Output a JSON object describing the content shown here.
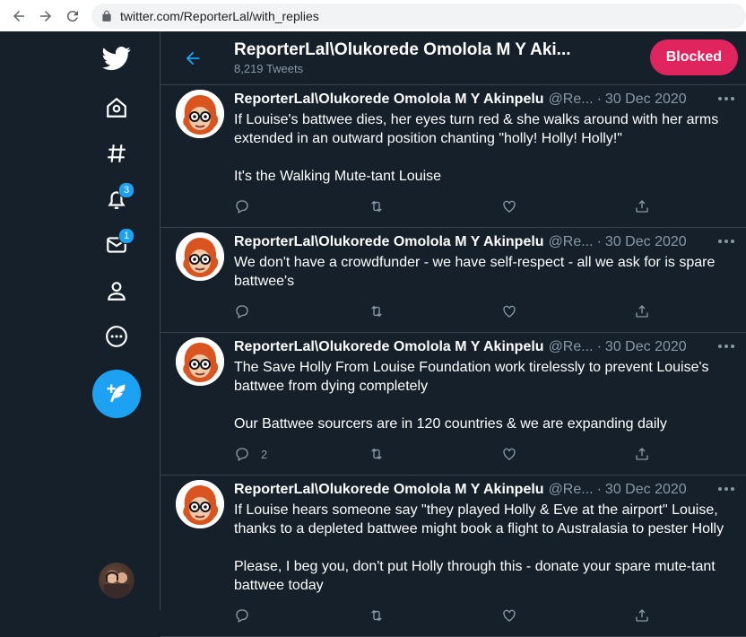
{
  "browser": {
    "url": "twitter.com/ReporterLal/with_replies"
  },
  "sidebar": {
    "notifications_badge": "3",
    "messages_badge": "1"
  },
  "header": {
    "title": "ReporterLal\\Olukorede Omolola M Y Aki...",
    "subtitle": "8,219 Tweets",
    "blocked_label": "Blocked"
  },
  "tweets": [
    {
      "name": "ReporterLal\\Olukorede Omolola M Y Akinpelu",
      "handle": "@Re...",
      "date": "30 Dec 2020",
      "text": "If Louise's battwee dies, her eyes turn red & she walks around with her arms extended in an outward position chanting \"holly! Holly! Holly!\"\n\nIt's the Walking Mute-tant Louise",
      "replies": ""
    },
    {
      "name": "ReporterLal\\Olukorede Omolola M Y Akinpelu",
      "handle": "@Re...",
      "date": "30 Dec 2020",
      "text": "We don't have a crowdfunder - we have self-respect - all we ask for is spare battwee's",
      "replies": ""
    },
    {
      "name": "ReporterLal\\Olukorede Omolola M Y Akinpelu",
      "handle": "@Re...",
      "date": "30 Dec 2020",
      "text": "The Save Holly From Louise Foundation work tirelessly to prevent Louise's battwee from dying completely\n\nOur Battwee sourcers are in 120 countries & we are expanding daily",
      "replies": "2"
    },
    {
      "name": "ReporterLal\\Olukorede Omolola M Y Akinpelu",
      "handle": "@Re...",
      "date": "30 Dec 2020",
      "text": "If Louise hears someone say \"they played Holly & Eve at the airport\" Louise, thanks to a depleted battwee might book a flight to Australasia to pester Holly\n\nPlease, I beg you, don't put Holly through this - donate your spare mute-tant battwee today",
      "replies": ""
    }
  ],
  "colors": {
    "background": "#15202b",
    "accent": "#1da1f2",
    "blocked": "#e0245e",
    "muted": "#8899a6"
  }
}
